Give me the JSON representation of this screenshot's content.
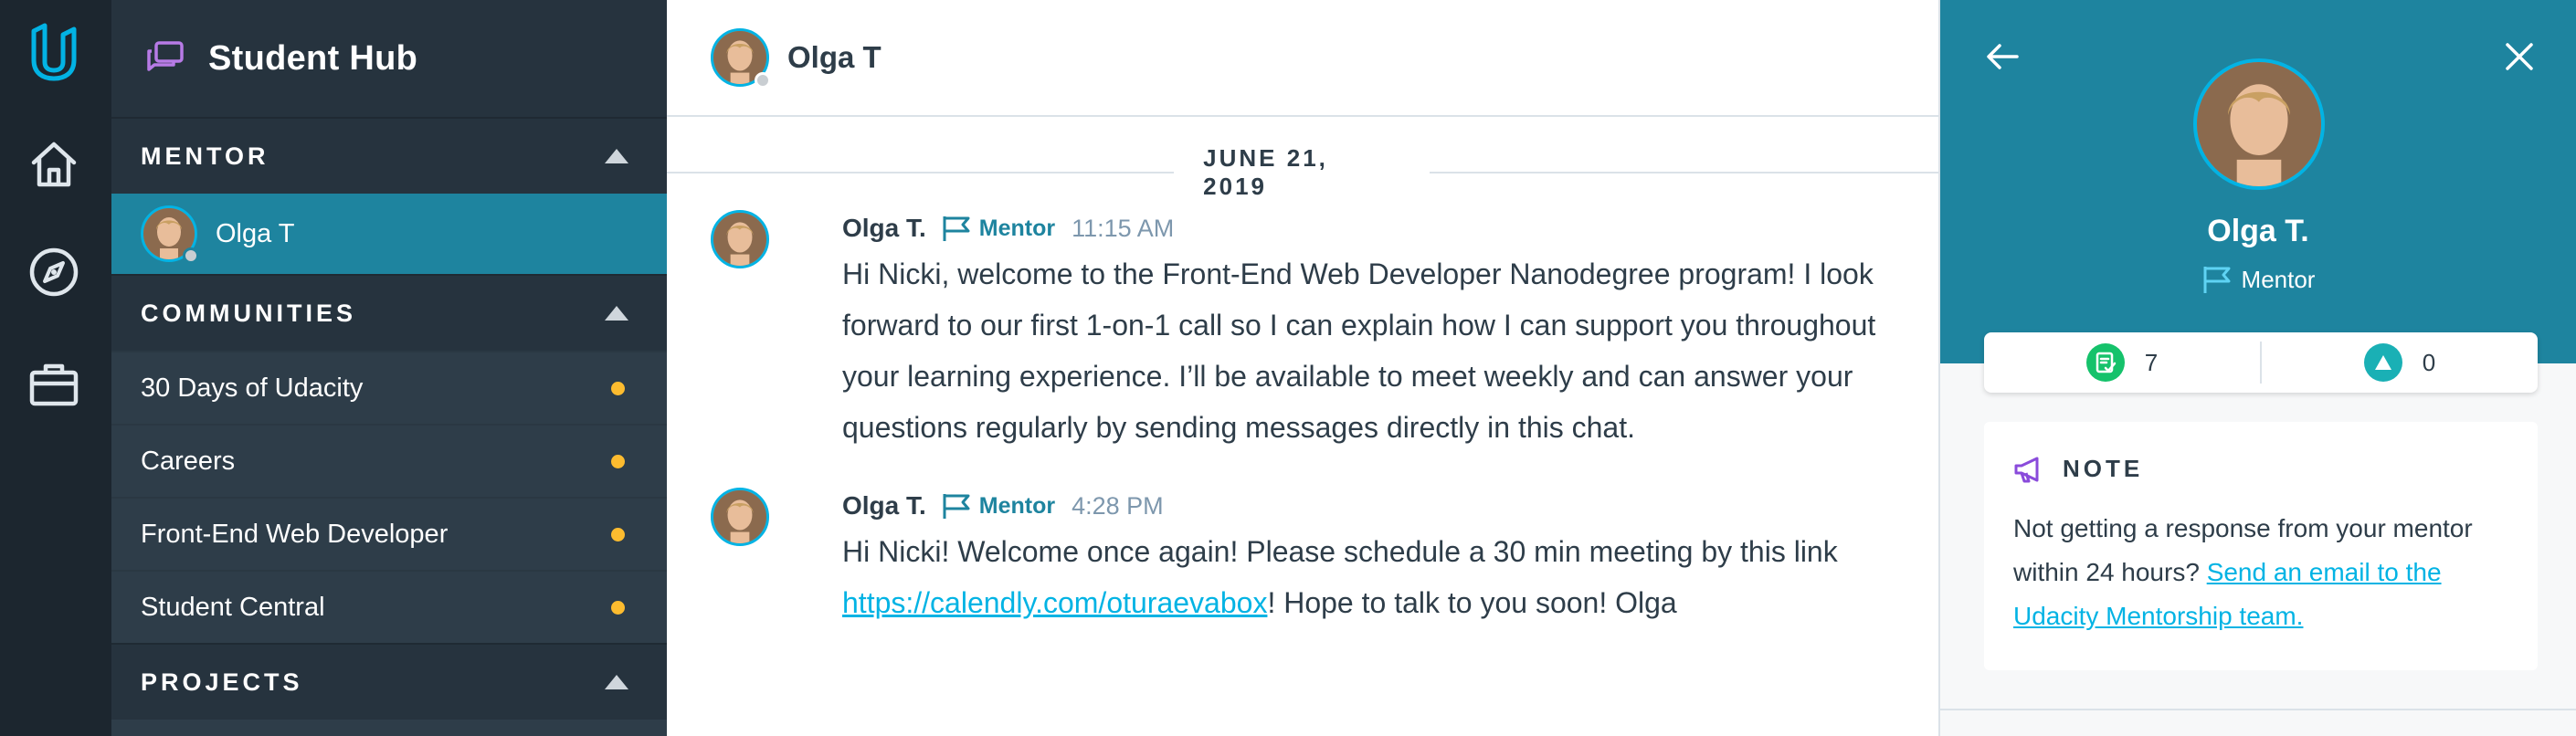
{
  "colors": {
    "rail_bg": "#1c262f",
    "sidebar_bg": "#2e3d49",
    "section_bg": "#26333e",
    "accent_teal": "#1e849f",
    "accent_blue": "#02b3e4",
    "unread_dot": "#fdbc2f",
    "note_icon": "#8a4bdb"
  },
  "rail": {
    "icons": [
      "udacity-logo-icon",
      "home-icon",
      "compass-icon",
      "briefcase-icon"
    ]
  },
  "sidebar": {
    "title": "Student Hub",
    "sections": {
      "mentor": "MENTOR",
      "communities": "COMMUNITIES",
      "projects": "PROJECTS"
    },
    "mentor_item": {
      "name": "Olga T"
    },
    "communities": [
      {
        "label": "30 Days of Udacity"
      },
      {
        "label": "Careers"
      },
      {
        "label": "Front-End Web Developer"
      },
      {
        "label": "Student Central"
      }
    ]
  },
  "chat": {
    "header_name": "Olga T",
    "date": "JUNE 21, 2019",
    "messages": [
      {
        "author": "Olga T.",
        "badge": "Mentor",
        "time": "11:15 AM",
        "text": "Hi Nicki, welcome to the Front-End Web Developer Nanodegree program! I look forward to our first 1-on-1 call so I can explain how I can support you throughout your learning experience. I’ll be available to meet weekly and can answer your questions regularly by sending messages directly in this chat."
      },
      {
        "author": "Olga T.",
        "badge": "Mentor",
        "time": "4:28 PM",
        "text_before": "Hi Nicki! Welcome once again! Please schedule a 30 min meeting by this link ",
        "link": "https://calendly.com/oturaevabox",
        "text_after": "! Hope to talk to you soon! Olga"
      }
    ]
  },
  "profile": {
    "name": "Olga T.",
    "role": "Mentor",
    "stats": {
      "reviews": "7",
      "upvotes": "0"
    },
    "note": {
      "title": "NOTE",
      "text": "Not getting a response from your mentor within 24 hours? ",
      "link": "Send an email to the Udacity Mentorship team."
    }
  }
}
